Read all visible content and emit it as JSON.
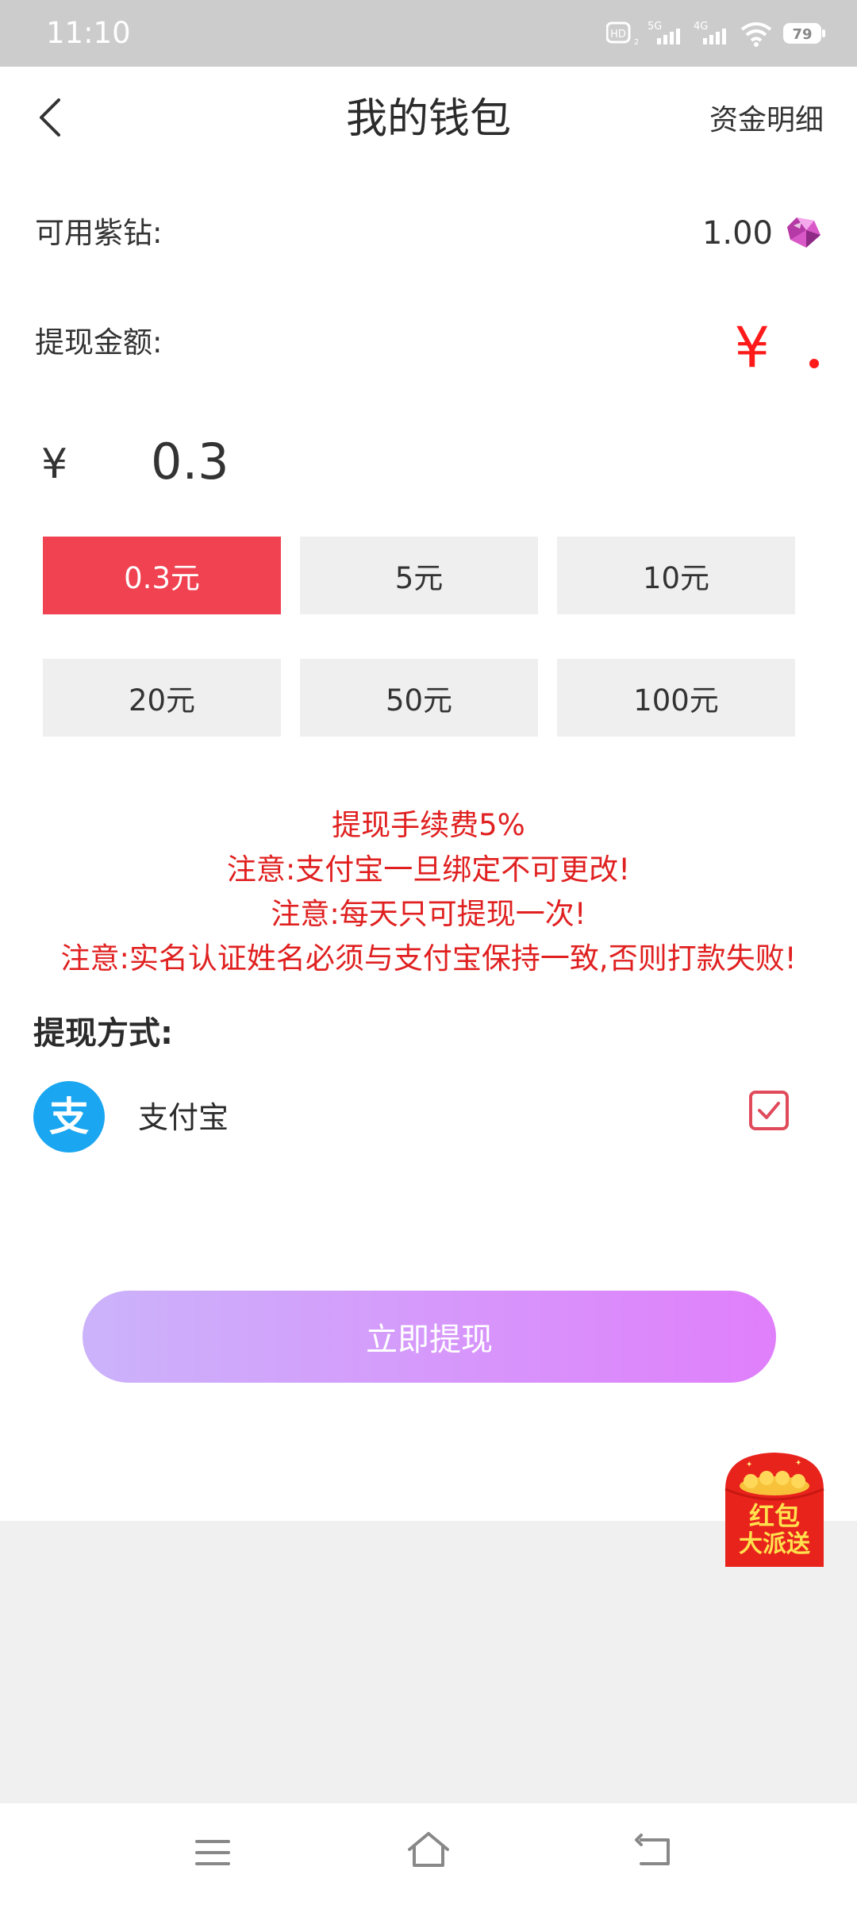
{
  "status_bar": {
    "time": "11:10",
    "battery": "79",
    "network_1": "5G",
    "network_2": "4G",
    "hd_label": "HD"
  },
  "header": {
    "title": "我的钱包",
    "detail_link": "资金明细"
  },
  "wallet": {
    "diamond_label": "可用紫钻:",
    "diamond_value": "1.00",
    "withdraw_label": "提现金额:",
    "currency_symbol": "¥",
    "amount_symbol": "¥",
    "amount_value": "0.3"
  },
  "options": [
    {
      "label": "0.3元",
      "selected": true
    },
    {
      "label": "5元",
      "selected": false
    },
    {
      "label": "10元",
      "selected": false
    },
    {
      "label": "20元",
      "selected": false
    },
    {
      "label": "50元",
      "selected": false
    },
    {
      "label": "100元",
      "selected": false
    }
  ],
  "notices": [
    "提现手续费5%",
    "注意:支付宝一旦绑定不可更改!",
    "注意:每天只可提现一次!",
    "注意:实名认证姓名必须与支付宝保持一致,否则打款失败!"
  ],
  "method": {
    "title": "提现方式:",
    "alipay_logo_char": "支",
    "alipay_name": "支付宝",
    "checked": true
  },
  "submit_label": "立即提现",
  "red_packet": {
    "line1": "红包",
    "line2": "大派送"
  },
  "colors": {
    "accent_red": "#f04250",
    "notice_red": "#e02020",
    "alipay_blue": "#1aa6f0",
    "button_gradient_start": "#cbb3fb",
    "button_gradient_end": "#e07ffb"
  }
}
